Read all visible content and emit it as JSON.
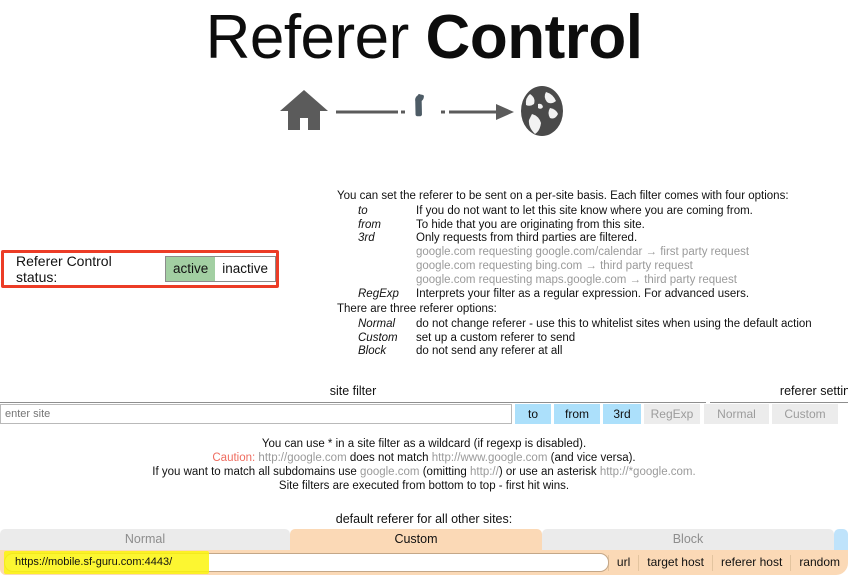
{
  "header": {
    "title_part1": "Referer",
    "title_part2": "Control",
    "icons": {
      "home": "home-icon",
      "wrench": "wrench-icon",
      "globe": "globe-icon",
      "arrow": "arrow-right-icon"
    }
  },
  "description_one": {
    "lead": "You can set the referer to be sent on a per-site basis. Each filter comes with four options:",
    "rows": [
      {
        "key": "to",
        "value": "If you do not want to let this site know where you are coming from."
      },
      {
        "key": "from",
        "value": "To hide that you are originating from this site."
      },
      {
        "key": "3rd",
        "value": "Only requests from third parties are filtered."
      },
      {
        "key": "RegExp",
        "value": "Interprets your filter as a regular expression. For advanced users."
      }
    ],
    "examples": [
      "google.com requesting google.com/calendar → first party request",
      "google.com requesting bing.com → third party request",
      "google.com requesting maps.google.com → third party request"
    ]
  },
  "description_two": {
    "lead": "There are three referer options:",
    "rows": [
      {
        "key": "Normal",
        "value": "do not change referer - use this to whitelist sites when using the default action"
      },
      {
        "key": "Custom",
        "value": "set up a custom referer to send"
      },
      {
        "key": "Block",
        "value": "do not send any referer at all"
      }
    ]
  },
  "status": {
    "label": "Referer Control status:",
    "options": [
      "active",
      "inactive"
    ],
    "selected": "active",
    "active_color": "#a2cfa2",
    "annotation_color": "#ec3c26"
  },
  "site_filter": {
    "section_label": "site filter",
    "referer_section_label": "referer settin",
    "input_placeholder": "enter site",
    "input_value": "",
    "option_buttons": [
      {
        "label": "to",
        "selected": true
      },
      {
        "label": "from",
        "selected": true
      },
      {
        "label": "3rd",
        "selected": true
      },
      {
        "label": "RegExp",
        "selected": false
      }
    ],
    "referer_buttons": [
      {
        "label": "Normal",
        "selected": false
      },
      {
        "label": "Custom",
        "selected": false
      }
    ],
    "selected_color": "#ace0fb"
  },
  "caution": {
    "line1": "You can use * in a site filter as a wildcard (if regexp is disabled).",
    "line2_warn": "Caution:",
    "line2_a": "http://google.com",
    "line2_b": "does not match",
    "line2_c": "http://www.google.com",
    "line2_d": "(and vice versa).",
    "line3_a": "If you want to match all subdomains use",
    "line3_b": "google.com",
    "line3_c": "(omitting",
    "line3_d": "http://",
    "line3_e": ") or use an asterisk",
    "line3_f": "http://*google.com.",
    "line4": "Site filters are executed from bottom to top - first hit wins.",
    "warn_color": "#ef6d60"
  },
  "default_referer": {
    "heading": "default referer for all other sites:",
    "tabs": [
      {
        "label": "Normal",
        "active": false
      },
      {
        "label": "Custom",
        "active": true
      },
      {
        "label": "Block",
        "active": false
      }
    ],
    "active_color": "#fbd9b6",
    "url_value": "https://mobile.sf-guru.com:4443/",
    "url_highlighted": true,
    "highlight_color": "#fbf40d",
    "buttons": [
      "url",
      "target host",
      "referer host",
      "random"
    ]
  }
}
